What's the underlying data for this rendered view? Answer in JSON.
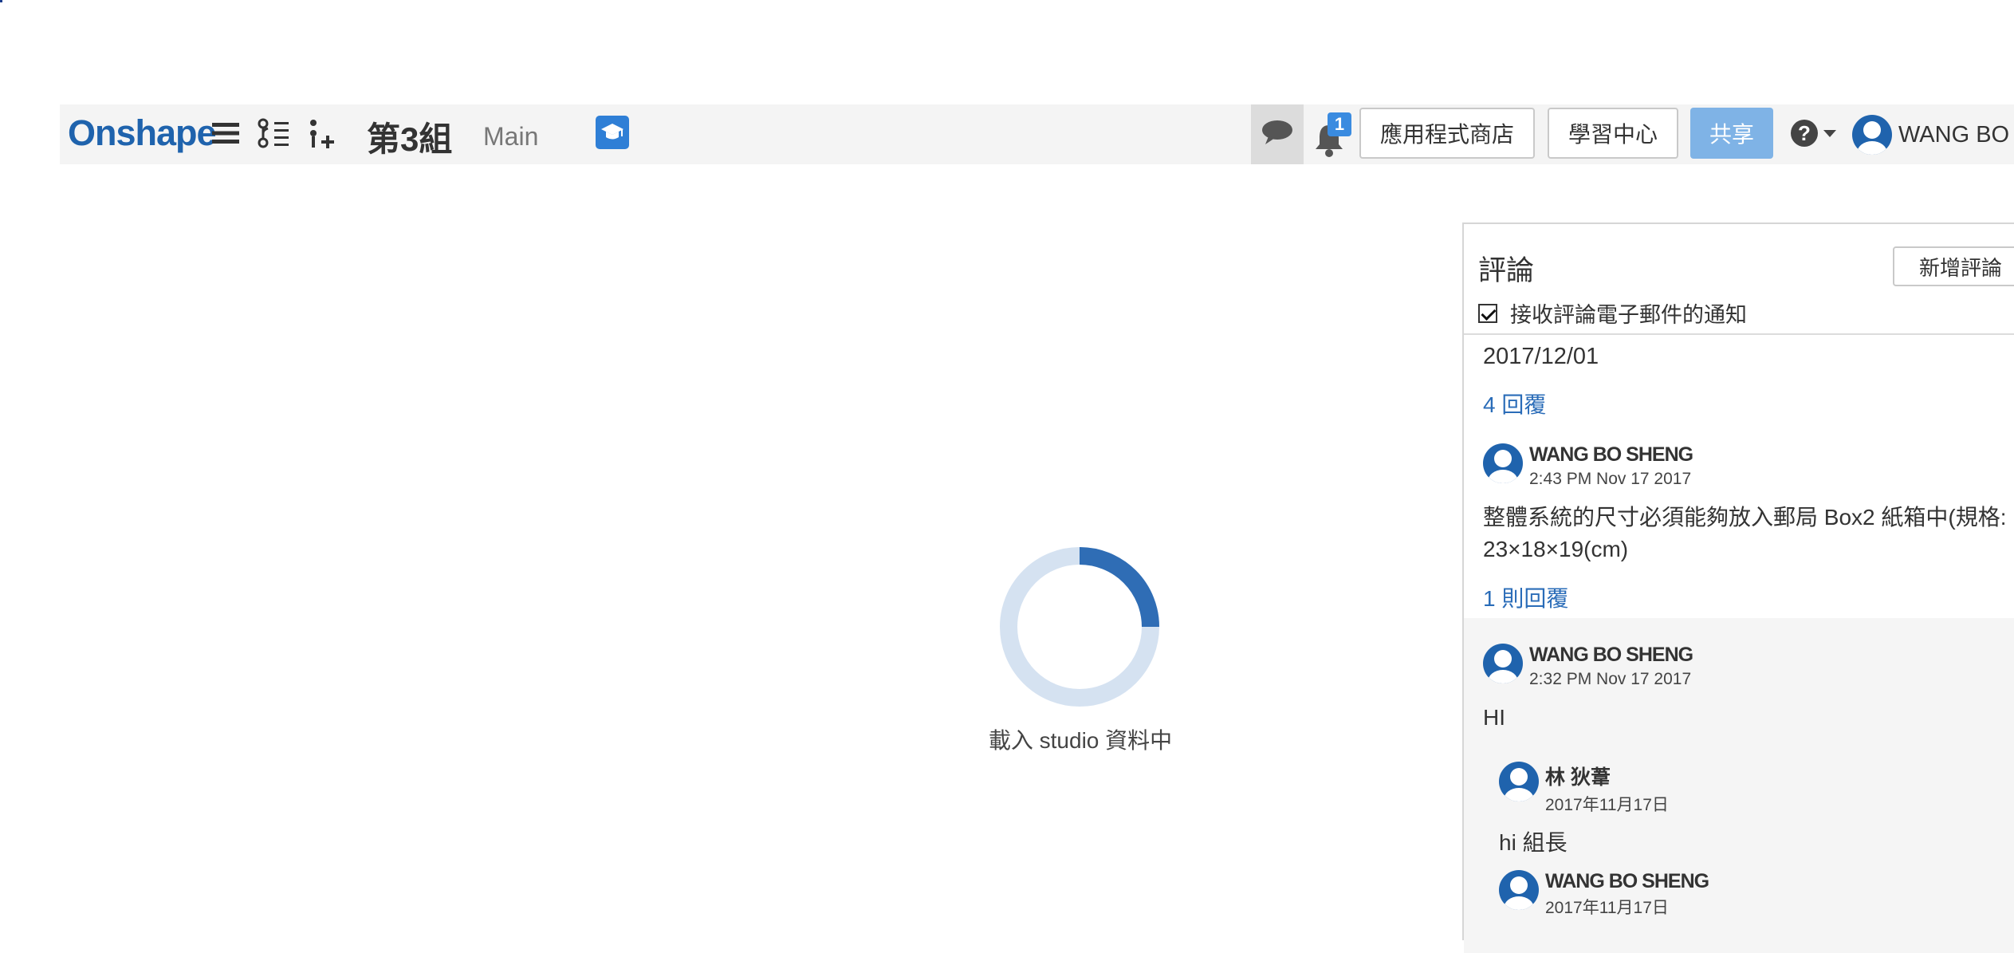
{
  "header": {
    "logo": "Onshape",
    "document_title": "第3組",
    "branch": "Main",
    "notification_count": "1",
    "app_store_label": "應用程式商店",
    "learning_center_label": "學習中心",
    "share_label": "共享",
    "user_name": "WANG BO S"
  },
  "icons": {
    "menu": "hamburger-menu-icon",
    "version_graph": "version-graph-icon",
    "insert": "insert-icon",
    "education": "graduation-cap-icon",
    "comments": "speech-bubble-icon",
    "notifications": "bell-icon",
    "help": "question-circle-icon",
    "avatar": "user-avatar-icon"
  },
  "colors": {
    "brand": "#1f63ad",
    "share_button": "#7fb3e6",
    "link": "#2a6cb8"
  },
  "loader": {
    "text": "載入 studio 資料中",
    "progress": 0.25
  },
  "comments_panel": {
    "title": "評論",
    "add_button": "新增評論",
    "notify_checkbox_label": "接收評論電子郵件的通知",
    "notify_checked": true,
    "date_heading": "2017/12/01",
    "replies_link": "4 回覆",
    "comments": [
      {
        "author": "WANG BO SHENG",
        "time": "2:43 PM Nov 17 2017",
        "body": "整體系統的尺寸必須能夠放入郵局 Box2 紙箱中(規格: 23×18×19(cm)",
        "replies_link": "1 則回覆"
      },
      {
        "author": "WANG BO SHENG",
        "time": "2:32 PM Nov 17 2017",
        "body": "HI",
        "replies": [
          {
            "author": "林 狄葦",
            "time": "2017年11月17日",
            "body": "hi 組長"
          },
          {
            "author": "WANG BO SHENG",
            "time": "2017年11月17日",
            "body": ""
          }
        ]
      }
    ]
  }
}
